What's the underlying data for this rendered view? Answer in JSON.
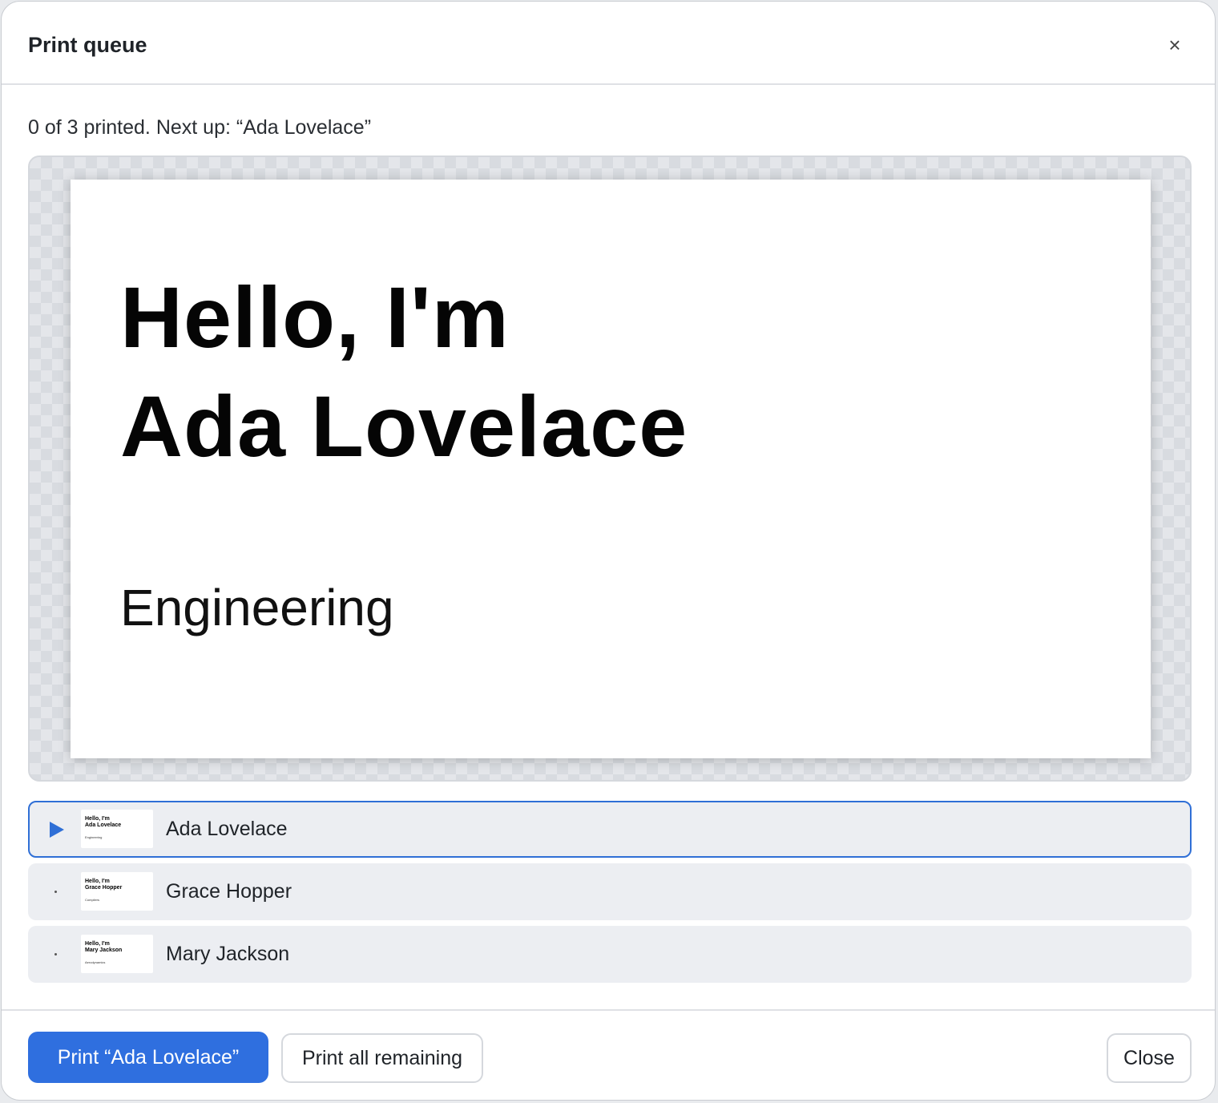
{
  "dialog": {
    "title": "Print queue",
    "close_icon": "close-icon",
    "close_glyph": "×"
  },
  "status": "0 of 3 printed. Next up: “Ada Lovelace”",
  "preview": {
    "greeting": "Hello, I'm",
    "name": "Ada Lovelace",
    "department": "Engineering"
  },
  "queue": [
    {
      "name": "Ada Lovelace",
      "state": "next",
      "marker": "play-icon",
      "thumb": {
        "greeting": "Hello, I'm",
        "name": "Ada Lovelace",
        "department": "Engineering"
      }
    },
    {
      "name": "Grace Hopper",
      "state": "pending",
      "marker": "dot-icon",
      "thumb": {
        "greeting": "Hello, I'm",
        "name": "Grace Hopper",
        "department": "Compilers"
      }
    },
    {
      "name": "Mary Jackson",
      "state": "pending",
      "marker": "dot-icon",
      "thumb": {
        "greeting": "Hello, I'm",
        "name": "Mary Jackson",
        "department": "Aerodynamics"
      }
    }
  ],
  "footer": {
    "print_current_label": "Print “Ada Lovelace”",
    "print_all_label": "Print all remaining",
    "close_label": "Close"
  },
  "colors": {
    "accent": "#2f6fdf",
    "surface": "#ffffff",
    "row_background": "#eceef2"
  }
}
